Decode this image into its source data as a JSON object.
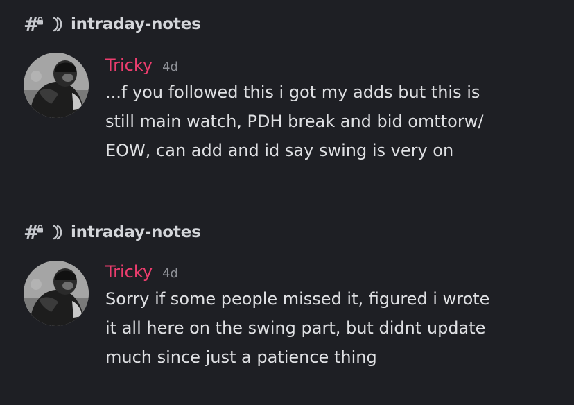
{
  "messages": [
    {
      "channel": {
        "name": "intraday-notes",
        "icon": "hash-lock-icon",
        "thread_icon": "thread-icon"
      },
      "author": "Tricky",
      "time": "4d",
      "lines": [
        "...f you followed this  i got my adds but this is",
        "still main watch, PDH break and bid omttorw/",
        "EOW, can add and id say swing is very on"
      ]
    },
    {
      "channel": {
        "name": "intraday-notes",
        "icon": "hash-lock-icon",
        "thread_icon": "thread-icon"
      },
      "author": "Tricky",
      "time": "4d",
      "lines": [
        "Sorry if some people missed it, figured i wrote",
        "it all here on the swing part, but didnt update",
        "much since just a patience thing"
      ]
    }
  ],
  "colors": {
    "background": "#1e1f24",
    "author": "#ec3d6e",
    "text": "#dfe0e3",
    "muted": "#8f9198"
  }
}
